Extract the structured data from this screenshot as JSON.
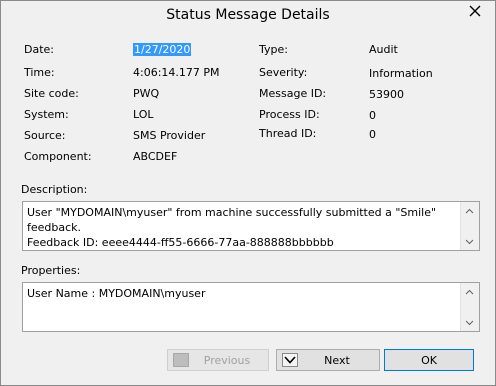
{
  "window": {
    "title": "Status Message Details"
  },
  "details_left": [
    {
      "label": "Date:",
      "value": "1/27/2020"
    },
    {
      "label": "Time:",
      "value": "4:06:14.177 PM"
    },
    {
      "label": "Site code:",
      "value": "PWQ"
    },
    {
      "label": "System:",
      "value": "LOL"
    },
    {
      "label": "Source:",
      "value": "SMS Provider"
    },
    {
      "label": "Component:",
      "value": "ABCDEF"
    }
  ],
  "details_right": [
    {
      "label": "Type:",
      "value": "Audit"
    },
    {
      "label": "Severity:",
      "value": "Information"
    },
    {
      "label": "Message ID:",
      "value": "53900"
    },
    {
      "label": "Process ID:",
      "value": "0"
    },
    {
      "label": "Thread ID:",
      "value": "0"
    }
  ],
  "description": {
    "label": "Description:",
    "text": "User \"MYDOMAIN\\myuser\" from machine successfully submitted a \"Smile\" feedback.\nFeedback ID: eeee4444-ff55-6666-77aa-888888bbbbbb"
  },
  "properties": {
    "label": "Properties:",
    "text": "User Name : MYDOMAIN\\myuser"
  },
  "buttons": {
    "previous": "Previous",
    "next": "Next",
    "ok": "OK"
  },
  "icons": {
    "close": "close-icon",
    "previous": "previous-icon",
    "next": "next-icon"
  }
}
